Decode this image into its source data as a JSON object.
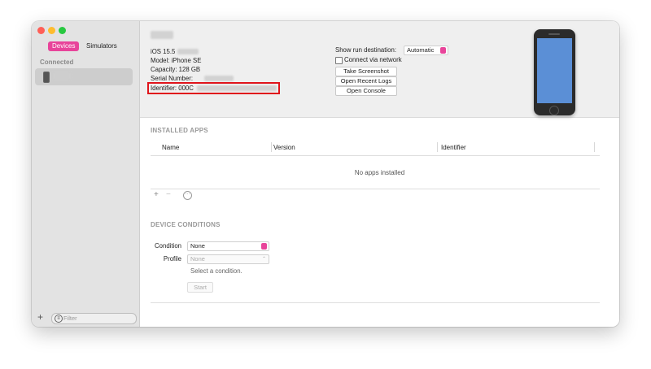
{
  "sidebar": {
    "tabs": {
      "devices": "Devices",
      "simulators": "Simulators"
    },
    "section_connected": "Connected",
    "filter_placeholder": "Filter",
    "add_icon": "plus-icon"
  },
  "device": {
    "ios_label": "iOS 15.5",
    "model": "Model: iPhone SE",
    "capacity": "Capacity: 128 GB",
    "serial_label": "Serial Number:",
    "identifier_label": "Identifier: 000C"
  },
  "controls": {
    "show_run_destination_label": "Show run destination:",
    "run_destination_value": "Automatic",
    "connect_via_network_label": "Connect via network",
    "take_screenshot": "Take Screenshot",
    "open_recent_logs": "Open Recent Logs",
    "open_console": "Open Console"
  },
  "installed_apps": {
    "title": "INSTALLED APPS",
    "columns": [
      "Name",
      "Version",
      "Identifier"
    ],
    "empty_message": "No apps installed",
    "add": "+",
    "remove": "−"
  },
  "device_conditions": {
    "title": "DEVICE CONDITIONS",
    "condition_label": "Condition",
    "condition_value": "None",
    "profile_label": "Profile",
    "profile_value": "None",
    "hint": "Select a condition.",
    "start": "Start"
  },
  "colors": {
    "accent": "#e8449a",
    "highlight_box": "#e0141b",
    "phone_screen": "#5b8fd6"
  }
}
